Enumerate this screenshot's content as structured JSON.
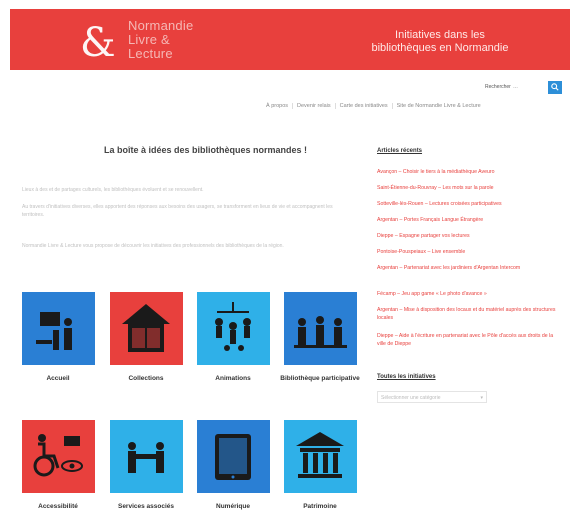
{
  "header": {
    "logo_mark": "&",
    "logo_lines": [
      "Normandie",
      "Livre &",
      "Lecture"
    ],
    "title_line1": "Initiatives dans les",
    "title_line2": "bibliothèques en Normandie",
    "bg_color": "#e8403d"
  },
  "search": {
    "label": "Rechercher",
    "placeholder": "…",
    "button_icon": "search-icon"
  },
  "nav": {
    "items": [
      "À propos",
      "Devenir relais",
      "Carte des initiatives",
      "Site de Normandie Livre & Lecture"
    ]
  },
  "main": {
    "title": "La boîte à idées des bibliothèques normandes !",
    "paragraphs": [
      "Lieux à des et de partages culturels, les bibliothèques évoluent et se renouvellent.",
      "Au travers d'initiatives diverses, elles apportent des réponses aux besoins des usagers, se transforment en lieux de vie et accompagnent les territoires.",
      "Normandie Livre & Lecture vous propose de découvrir les initiatives des professionnels des bibliothèques de la région."
    ]
  },
  "tiles": [
    {
      "label": "Accueil",
      "color": "#2a7fd4",
      "icon": "reception-icon"
    },
    {
      "label": "Collections",
      "color": "#e8403d",
      "icon": "book-house-icon"
    },
    {
      "label": "Animations",
      "color": "#2fb0e8",
      "icon": "mobile-icon"
    },
    {
      "label": "Bibliothèque participative",
      "color": "#2a7fd4",
      "icon": "group-icon"
    },
    {
      "label": "Accessibilité",
      "color": "#e8403d",
      "icon": "accessibility-icon"
    },
    {
      "label": "Services associés",
      "color": "#2fb0e8",
      "icon": "handshake-icon"
    },
    {
      "label": "Numérique",
      "color": "#2a7fd4",
      "icon": "tablet-icon"
    },
    {
      "label": "Patrimoine",
      "color": "#2fb0e8",
      "icon": "museum-icon"
    }
  ],
  "sidebar": {
    "recent_heading": "Articles récents",
    "recent_links": [
      "Avançon – Choisir le tiers à la médiathèque Aveuro",
      "Saint-Étienne-du-Rouvray – Les mots sur la parole",
      "Sotteville-lès-Rouen – Lectures croisées participatives",
      "Argentan – Portes Français Langue Étrangère",
      "Dieppe – Espagne partager vos lectures",
      "Pontoise-Pouspeiaux – Live ensemble",
      "Argentan – Partenariat avec les jardiniers d'Argentan Intercom",
      "Fécamp – Jeu app game « Le photo d'avance »",
      "Argentan – Mise à disposition des locaux et du matériel auprès des structures locales",
      "Dieppe – Aide à l'écriture en partenariat avec le Pôle d'accès aux droits de la ville de Dieppe"
    ],
    "all_heading": "Toutes les initiatives",
    "select_value": "Sélectionner une catégorie"
  }
}
